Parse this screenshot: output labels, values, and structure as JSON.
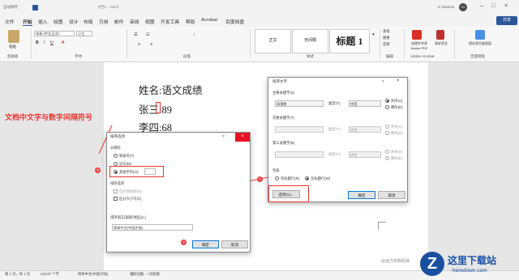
{
  "title_bar": {
    "autosave": "自动保存",
    "doc_title": "文档1 - Word",
    "user": "Z Xiaomei",
    "avatar_initial": "ZX"
  },
  "menu": {
    "items": [
      "文件",
      "开始",
      "插入",
      "绘图",
      "设计",
      "布局",
      "引用",
      "邮件",
      "审阅",
      "视图",
      "开发工具",
      "帮助",
      "Acrobat",
      "百度网盘"
    ],
    "share": "共享"
  },
  "ribbon": {
    "groups": [
      "剪贴板",
      "字体",
      "段落",
      "样式",
      "编辑",
      "Adobe Acrobat",
      "百度网盘"
    ],
    "paste": "粘贴",
    "font_name": "宋体 (中文正文)",
    "font_size": "小三",
    "styles": [
      "正文",
      "无间隔",
      "标题 1"
    ],
    "editing": [
      "查找",
      "替换",
      "选择"
    ],
    "acrobat": "创建并共享 Adobe PDF",
    "sign": "请求签名",
    "baidu": "保存到百度网盘"
  },
  "document": {
    "lines": [
      "姓名:语文成绩",
      "张三:89",
      "李四:68"
    ]
  },
  "annotation": {
    "text": "文档中文字与数字间隔符号",
    "steps": [
      "①",
      "②",
      "③"
    ]
  },
  "sort_dialog": {
    "title": "排序文字",
    "help": "?",
    "close": "×",
    "key1_label": "主要关键字(S)",
    "key1_value": "段落数",
    "type_label": "类型(Y):",
    "type_value": "拼音",
    "asc": "升序(A)",
    "desc": "降序(D)",
    "key2_label": "次要关键字(T)",
    "key3_label": "第三关键字(B)",
    "list_label": "列表",
    "has_header": "有标题行(R)",
    "no_header": "无标题行(W)",
    "options": "选项(O)...",
    "ok": "确定",
    "cancel": "取消"
  },
  "options_dialog": {
    "title": "排序选项",
    "help": "?",
    "close": "×",
    "sep_label": "分隔符",
    "tab": "制表符(T)",
    "comma": "逗号(M)",
    "other": "其他字符(O):",
    "other_value": ":",
    "sort_opts_label": "排序选项",
    "sort_col": "仅对列排序(O)",
    "case": "区分大小写(C)",
    "lang_label": "排序语言(国家/地区)(L)",
    "lang_value": "简体中文(中国大陆)",
    "ok": "确定",
    "cancel": "取消"
  },
  "status_bar": {
    "page": "第 1 页，共 1 页",
    "words": "22/137 个字",
    "lang": "简体中文(中国大陆)",
    "access": "辅助功能: 一切就绪"
  },
  "watermark": {
    "site": "这里下载站",
    "domain": "heredown.com",
    "note": "@远方的数码侠"
  }
}
